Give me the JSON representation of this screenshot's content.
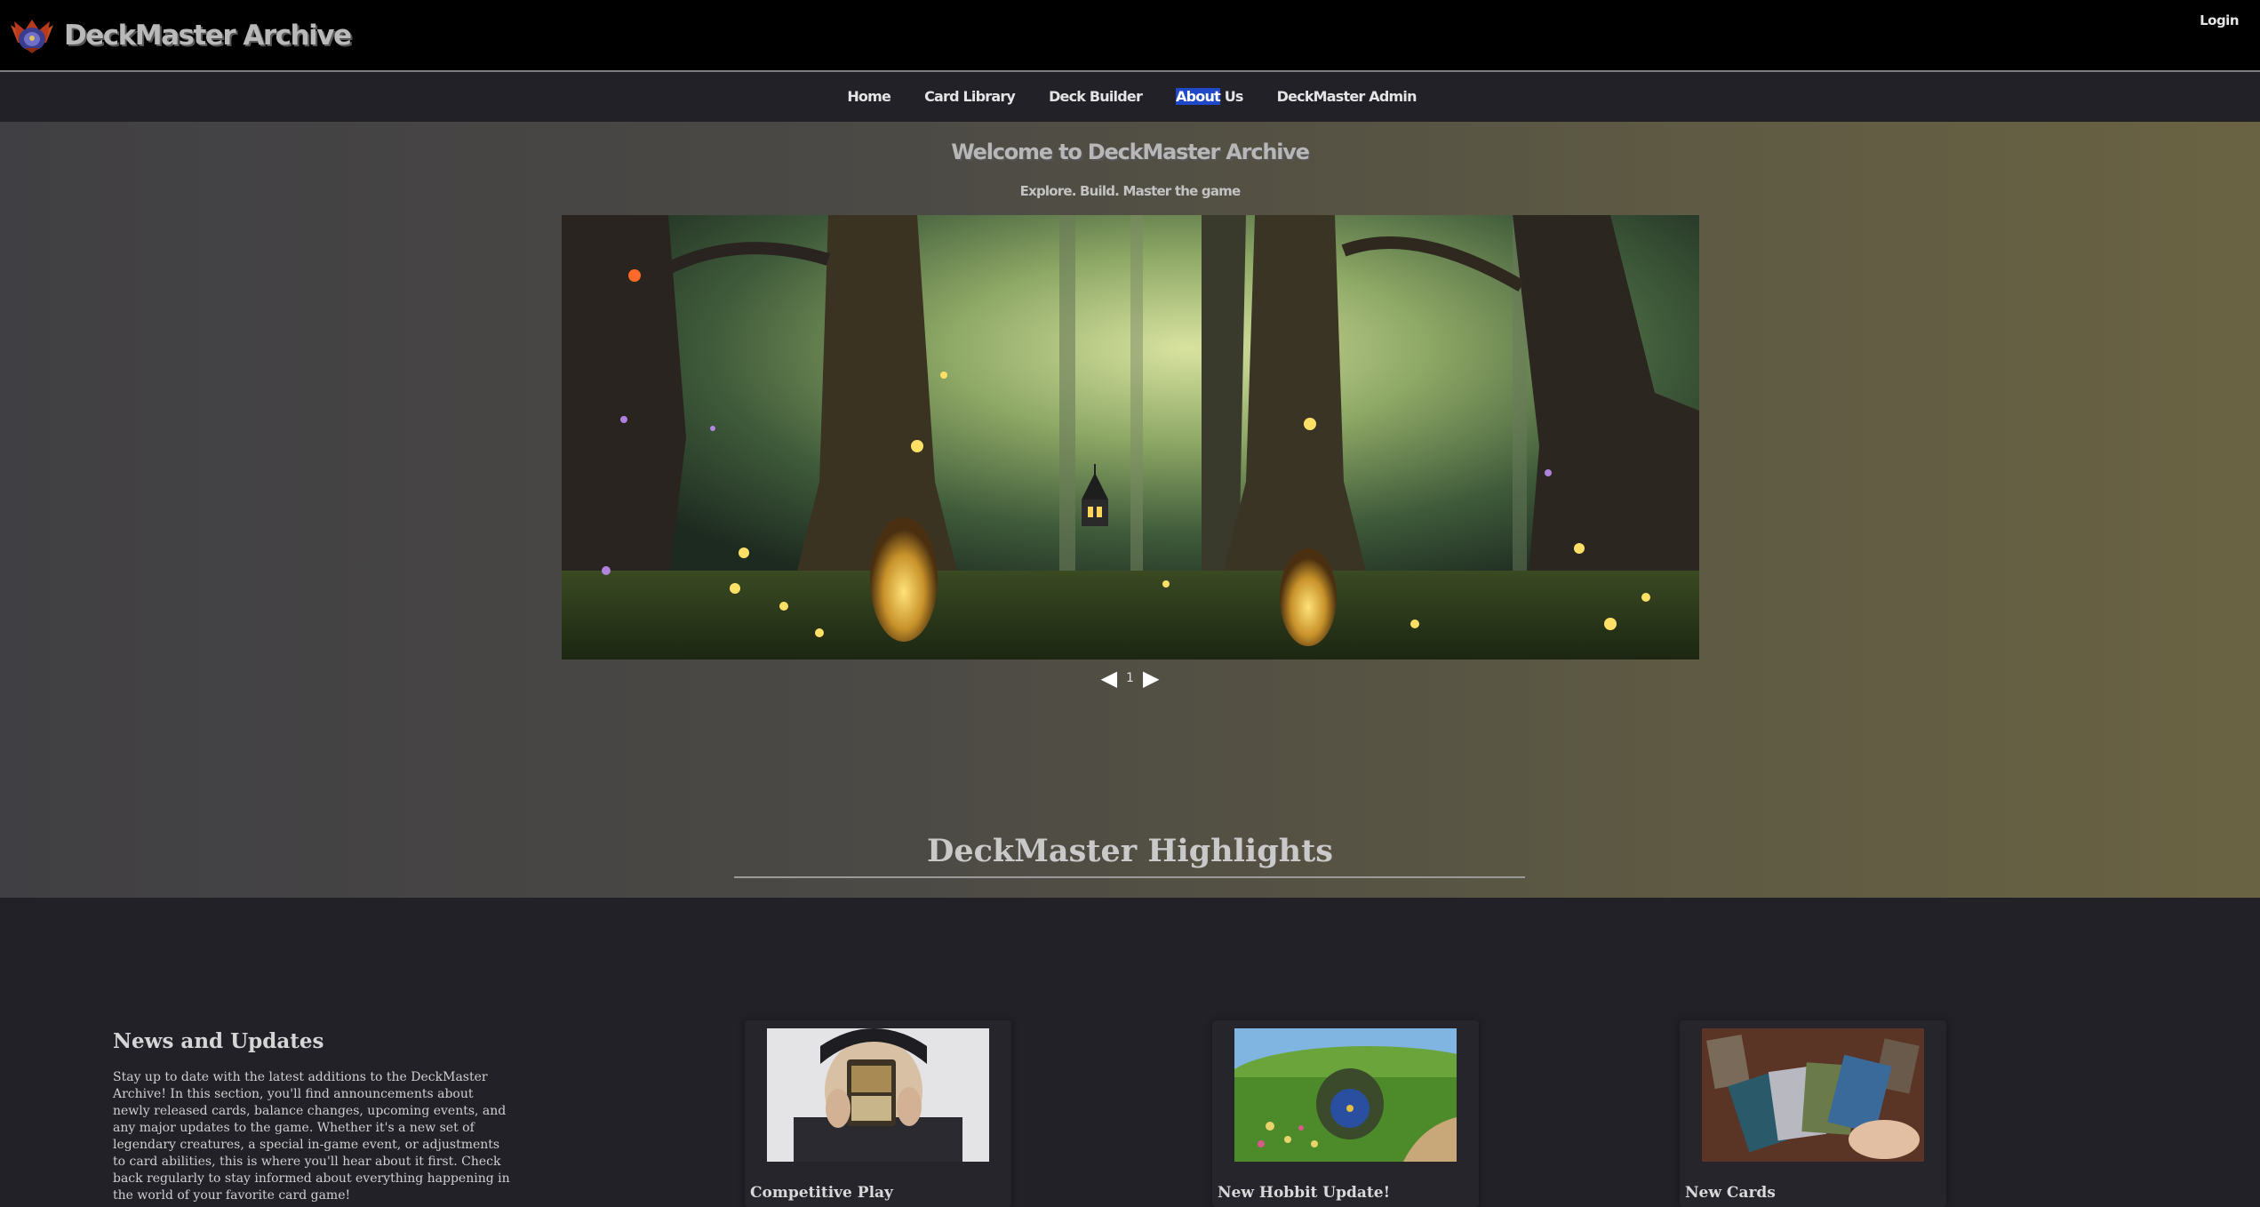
{
  "header": {
    "brand": "DeckMaster Archive",
    "login_label": "Login"
  },
  "nav": {
    "items": [
      "Home",
      "Card Library",
      "Deck Builder",
      "About Us",
      "DeckMaster Admin"
    ],
    "about_highlight": "About",
    "about_rest": " Us"
  },
  "hero": {
    "title": "Welcome to DeckMaster Archive",
    "subtitle": "Explore. Build. Master the game",
    "carousel": {
      "current_page": "1",
      "prev_icon": "triangle-left",
      "next_icon": "triangle-right"
    }
  },
  "highlights": {
    "title": "DeckMaster Highlights"
  },
  "news": {
    "title": "News and Updates",
    "body": "Stay up to date with the latest additions to the DeckMaster Archive! In this section, you'll find announcements about newly released cards, balance changes, upcoming events, and any major updates to the game. Whether it's a new set of legendary creatures, a special in-game event, or adjustments to card abilities, this is where you'll hear about it first. Check back regularly to stay informed about everything happening in the world of your favorite card game!"
  },
  "cards": [
    {
      "title": "Competitive Play"
    },
    {
      "title": "New Hobbit Update!"
    },
    {
      "title": "New Cards"
    }
  ],
  "colors": {
    "accent_highlight": "#1f49c9",
    "topbar": "#000000",
    "page_bg": "#222127"
  }
}
